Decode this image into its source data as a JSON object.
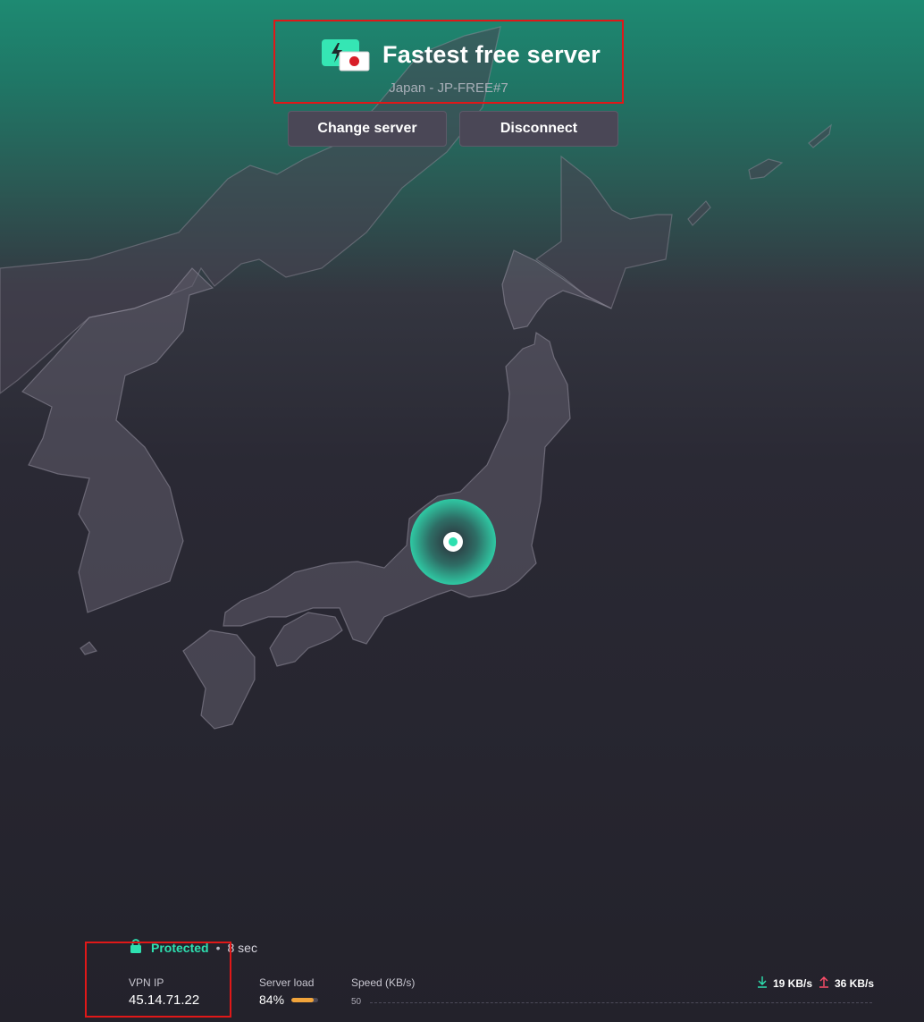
{
  "connection": {
    "title": "Fastest free server",
    "subtitle": "Japan - JP-FREE#7",
    "country_icon": "japan-flag-icon",
    "server_icon": "lightning-icon"
  },
  "actions": {
    "change_server": "Change server",
    "disconnect": "Disconnect"
  },
  "status": {
    "label": "Protected",
    "separator": "•",
    "time": "8 sec"
  },
  "stats": {
    "vpn_ip_label": "VPN IP",
    "vpn_ip": "45.14.71.22",
    "server_load_label": "Server load",
    "server_load": "84%",
    "server_load_fraction": 0.84,
    "speed_label": "Speed (KB/s)",
    "axis_50": "50",
    "download": "19 KB/s",
    "upload": "36 KB/s"
  },
  "colors": {
    "accent": "#2ee0b0",
    "download_icon": "#2ee0b0",
    "upload_icon": "#ff4d6a",
    "load_bar": "#f1a43b",
    "highlight_box": "#e01818"
  }
}
